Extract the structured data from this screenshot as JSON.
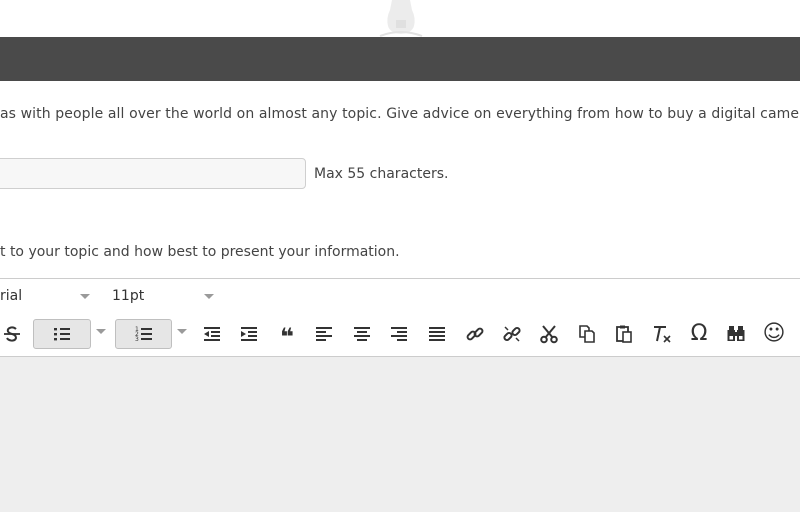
{
  "intro_text": "as with people all over the world on almost any topic. Give advice on everything from how to buy a digital camera to how to",
  "title_field": {
    "value": "",
    "max_note": "Max 55 characters."
  },
  "hint_text": "t to your topic and how best to present your information.",
  "editor": {
    "font_family": "rial",
    "font_size": "11pt",
    "toolbar_icons": [
      "strikethrough-icon",
      "bullet-list-icon",
      "numbered-list-icon",
      "outdent-icon",
      "indent-icon",
      "blockquote-icon",
      "align-left-icon",
      "align-center-icon",
      "align-right-icon",
      "align-justify-icon",
      "link-icon",
      "unlink-icon",
      "cut-icon",
      "copy-icon",
      "paste-icon",
      "clear-format-icon",
      "special-char-icon",
      "find-replace-icon",
      "emoticon-icon"
    ]
  },
  "special_char_glyph": "Ω",
  "emoticon_glyph": "☺",
  "blockquote_glyph": "❝",
  "colors": {
    "top_bar": "#4a4a4a",
    "editor_bg": "#eeeeee",
    "icon": "#333333"
  }
}
